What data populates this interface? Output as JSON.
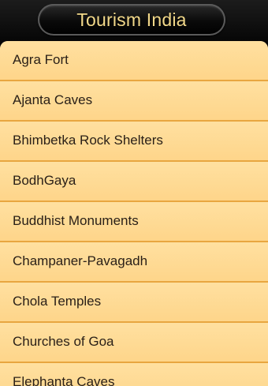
{
  "header": {
    "title": "Tourism India"
  },
  "list": {
    "items": [
      {
        "label": "Agra Fort"
      },
      {
        "label": "Ajanta Caves"
      },
      {
        "label": "Bhimbetka Rock Shelters"
      },
      {
        "label": "BodhGaya"
      },
      {
        "label": "Buddhist Monuments"
      },
      {
        "label": "Champaner-Pavagadh"
      },
      {
        "label": "Chola Temples"
      },
      {
        "label": "Churches of Goa"
      },
      {
        "label": "Elephanta Caves"
      }
    ]
  },
  "colors": {
    "title_text": "#f3d98a",
    "list_background": "#ffd992",
    "separator": "#e8a640",
    "item_text": "#2a2018"
  }
}
